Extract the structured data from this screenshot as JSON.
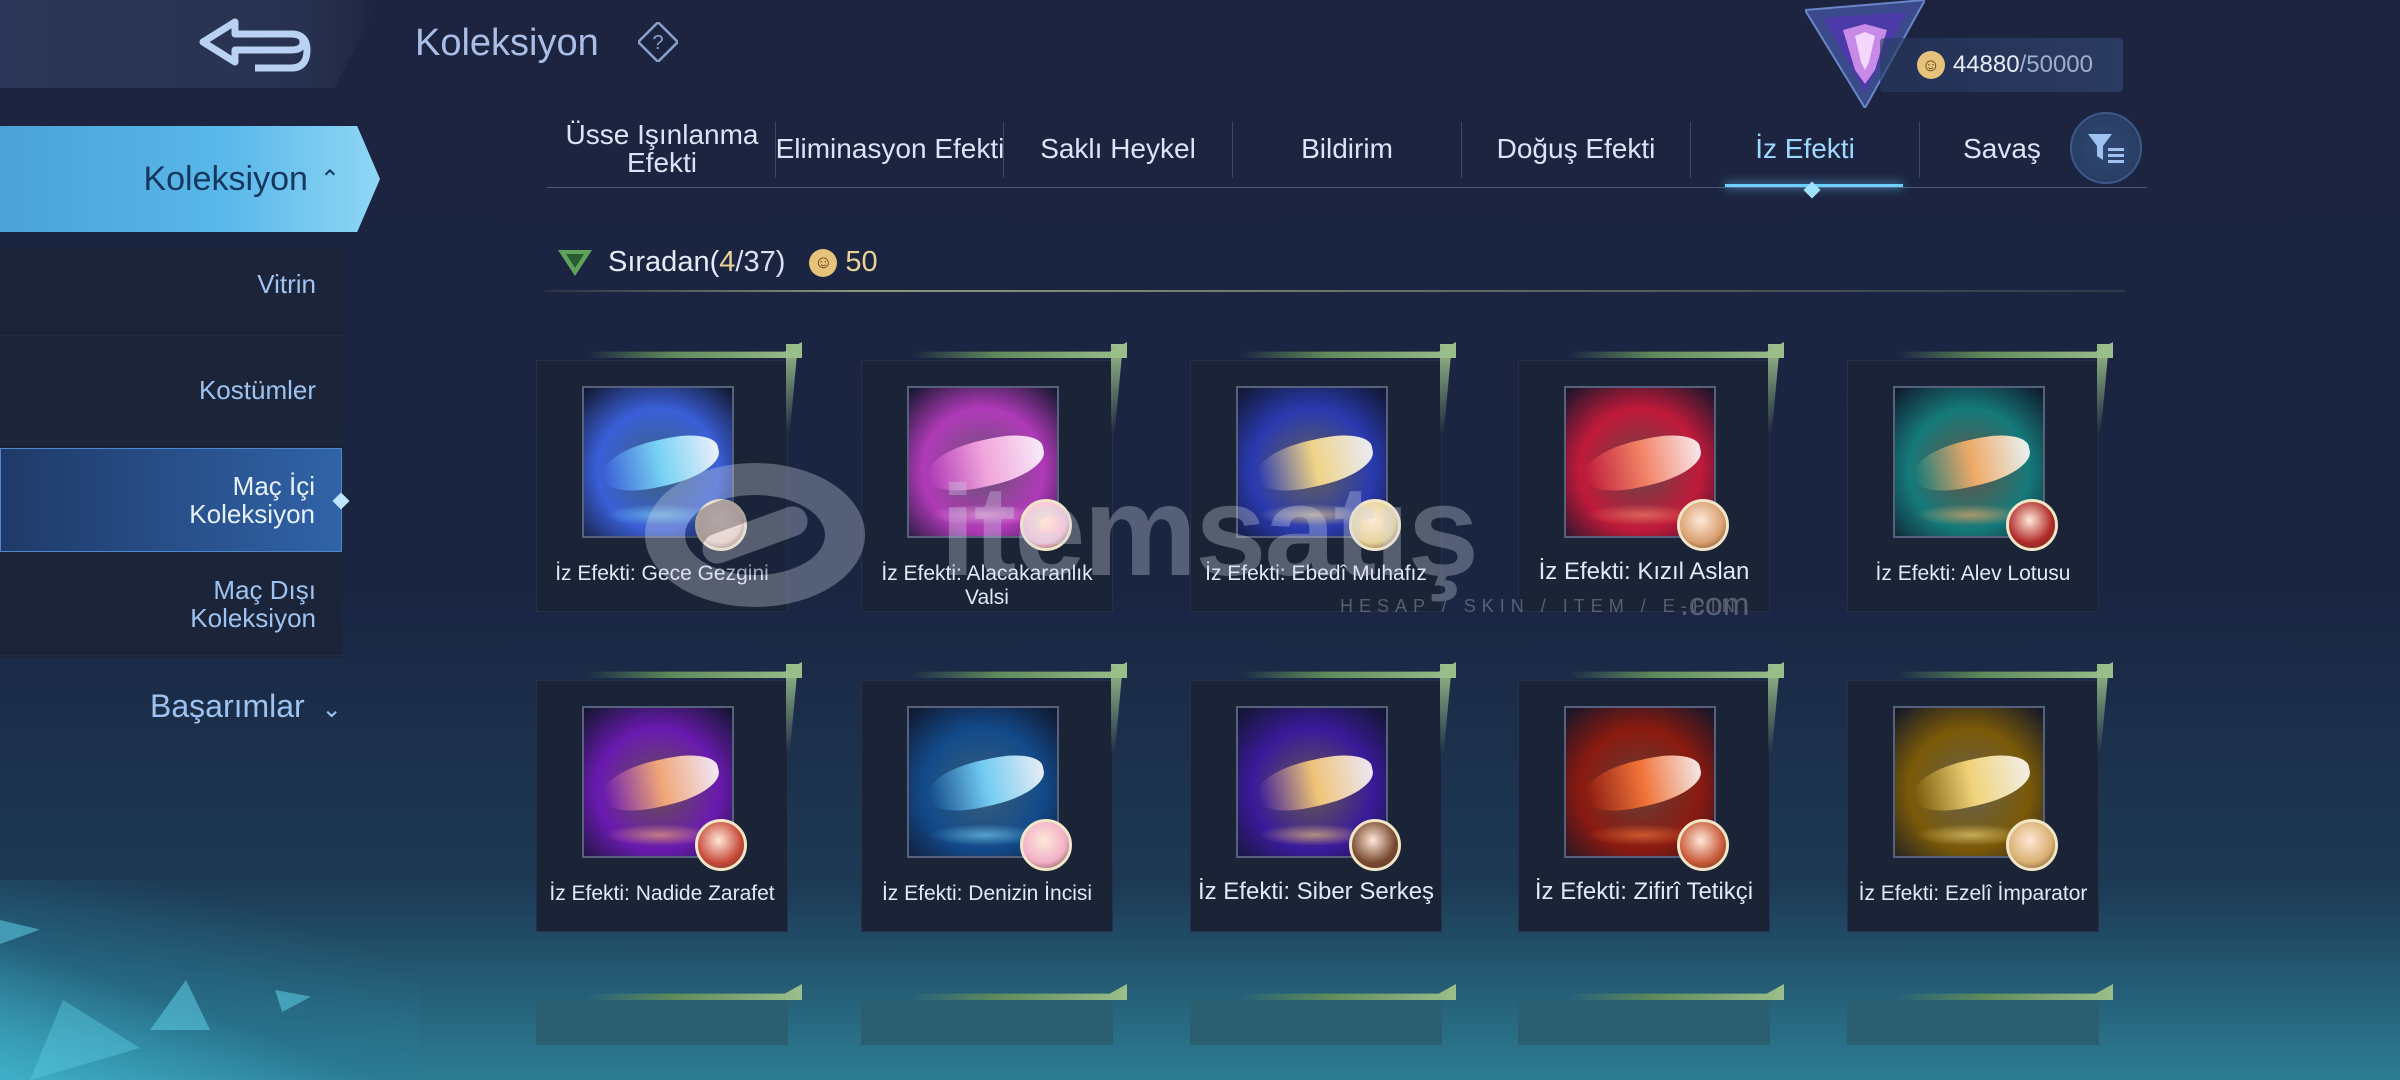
{
  "header": {
    "title": "Koleksiyon",
    "help_icon": "question-icon",
    "currency": {
      "current": "44880",
      "max": "/50000",
      "icon": "coin-icon"
    }
  },
  "sidebar": {
    "active": "Koleksiyon",
    "items": [
      {
        "label": "Vitrin"
      },
      {
        "label": "Kostümler"
      },
      {
        "label": "Maç İçi\nKoleksiyon",
        "selected": true
      },
      {
        "label": "Maç Dışı\nKoleksiyon"
      }
    ],
    "achievements": "Başarımlar"
  },
  "tabs": [
    {
      "label": "Üsse Işınlanma Efekti"
    },
    {
      "label": "Eliminasyon Efekti"
    },
    {
      "label": "Saklı Heykel"
    },
    {
      "label": "Bildirim"
    },
    {
      "label": "Doğuş Efekti"
    },
    {
      "label": "İz Efekti",
      "active": true
    },
    {
      "label": "Savaş"
    }
  ],
  "section": {
    "title": "Sıradan",
    "count_open": "(",
    "count_owned": "4",
    "count_total": "/37)",
    "reward": "50"
  },
  "cards": [
    {
      "label": "İz Efekti: Gece Gezgini",
      "color1": "#3a5fd8",
      "color2": "#7fe0ff"
    },
    {
      "label": "İz Efekti: Alacakaranlık Valsi",
      "color1": "#b03ab8",
      "color2": "#ffb0e6"
    },
    {
      "label": "İz Efekti: Ebedî Muhafız",
      "color1": "#2a3ab0",
      "color2": "#ffe08a"
    },
    {
      "label": "İz Efekti: Kızıl Aslan",
      "color1": "#c01a3a",
      "color2": "#ff8a6a"
    },
    {
      "label": "İz Efekti: Alev Lotusu",
      "color1": "#157a7a",
      "color2": "#ffb36a"
    },
    {
      "label": "İz Efekti: Nadide Zarafet",
      "color1": "#6a1ab0",
      "color2": "#ffb07a"
    },
    {
      "label": "İz Efekti: Denizin İncisi",
      "color1": "#124a8a",
      "color2": "#7ad8ff"
    },
    {
      "label": "İz Efekti: Siber Serkeş",
      "color1": "#3a1a9a",
      "color2": "#ffd07a"
    },
    {
      "label": "İz Efekti: Zifirî Tetikçi",
      "color1": "#8a1a10",
      "color2": "#ff7a3a"
    },
    {
      "label": "İz Efekti: Ezelî İmparator",
      "color1": "#7a5a08",
      "color2": "#ffe080"
    }
  ],
  "watermark": {
    "brand": "itemsatış",
    "tagline": "HESAP / SKIN / ITEM / E-PIN",
    "suffix": ".com"
  }
}
